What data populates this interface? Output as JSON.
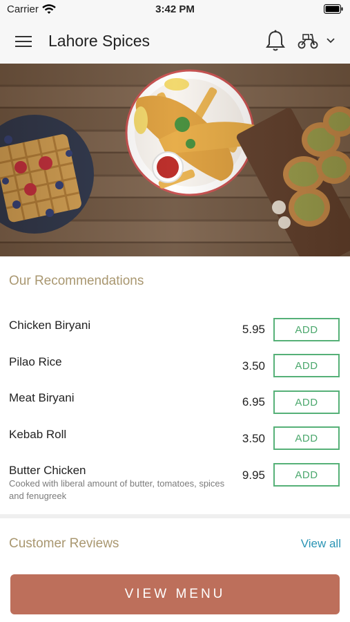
{
  "status_bar": {
    "carrier": "Carrier",
    "time": "3:42 PM"
  },
  "nav": {
    "title": "Lahore Spices",
    "icons": [
      "menu-icon",
      "bell-icon",
      "scooter-icon",
      "chevron-down-icon"
    ]
  },
  "hero": {
    "image": "food-banner"
  },
  "recommendations": {
    "title": "Our Recommendations",
    "add_label": "ADD",
    "items": [
      {
        "name": "Chicken Biryani",
        "price": "5.95",
        "description": ""
      },
      {
        "name": "Pilao Rice",
        "price": "3.50",
        "description": ""
      },
      {
        "name": "Meat Biryani",
        "price": "6.95",
        "description": ""
      },
      {
        "name": "Kebab Roll",
        "price": "3.50",
        "description": ""
      },
      {
        "name": "Butter Chicken",
        "price": "9.95",
        "description": "Cooked with liberal amount of butter, tomatoes, spices and fenugreek"
      }
    ]
  },
  "reviews": {
    "title": "Customer Reviews",
    "view_all_label": "View all"
  },
  "footer": {
    "view_menu_label": "VIEW MENU"
  },
  "colors": {
    "accent_gold": "#a99770",
    "add_green": "#4aa76c",
    "link_blue": "#2a94b4",
    "button_terracotta": "#bd6f5b"
  }
}
